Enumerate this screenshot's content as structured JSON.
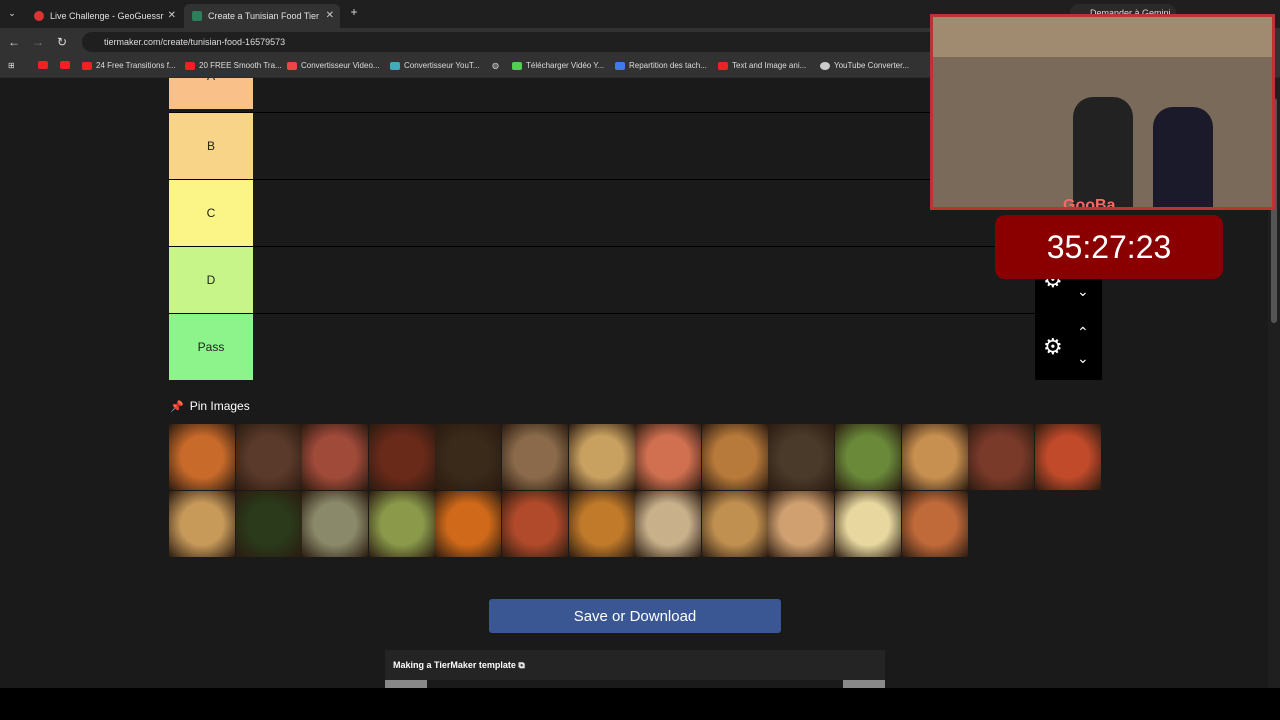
{
  "browser": {
    "tabs": [
      {
        "label": "Live Challenge - GeoGuessr",
        "active": false
      },
      {
        "label": "Create a Tunisian Food Tier List",
        "active": true
      }
    ],
    "url": "tiermaker.com/create/tunisian-food-16579573",
    "gemini_label": "Demander à Gemini",
    "bookmarks": [
      "24 Free Transitions f...",
      "20 FREE Smooth Tra...",
      "Convertisseur Video...",
      "Convertisseur YouT...",
      "Télécharger Vidéo Y...",
      "Repartition des tach...",
      "Text and Image ani...",
      "YouTube Converter..."
    ]
  },
  "tiers": [
    {
      "label": "A",
      "color": "#f9c08a"
    },
    {
      "label": "B",
      "color": "#f8d489"
    },
    {
      "label": "C",
      "color": "#fbf588"
    },
    {
      "label": "D",
      "color": "#c7f58a"
    },
    {
      "label": "Pass",
      "color": "#8cf48a"
    }
  ],
  "pin_label": "Pin Images",
  "save_label": "Save or Download",
  "template_label": "Making a TierMaker template",
  "timer": "35:27:23",
  "overlay_name": "GooBa",
  "food_colors": [
    "#c86a2a",
    "#5a3a2a",
    "#a04a3a",
    "#6a2a1a",
    "#3a2a1a",
    "#8a6a4a",
    "#c8a060",
    "#d07050",
    "#b87a3a",
    "#4a3a2a",
    "#6a8a3a",
    "#c89050",
    "#7a3a2a",
    "#c04a2a",
    "#c89a5a",
    "#2a3a1a",
    "#8a8a6a",
    "#8a9a4a",
    "#d06a1a",
    "#b04a2a",
    "#c07a2a",
    "#c8b08a",
    "#c09050",
    "#d0a070",
    "#e8d8a0",
    "#c06a3a"
  ]
}
